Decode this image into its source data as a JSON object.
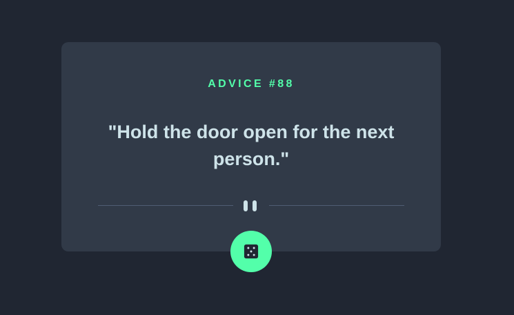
{
  "advice": {
    "id_label": "ADVICE #88",
    "quote": "\"Hold the door open for the next person.\""
  },
  "dice_button": {
    "icon": "dice-icon"
  },
  "colors": {
    "background": "#202632",
    "card": "#313A48",
    "accent": "#53FFAA",
    "text": "#CEE3E9",
    "divider": "#4F5D74"
  }
}
